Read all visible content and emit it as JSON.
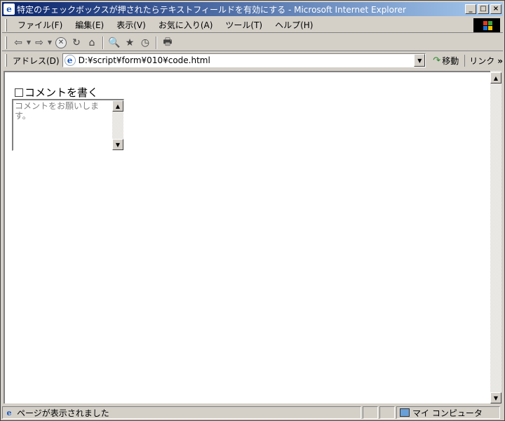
{
  "window": {
    "title": "特定のチェックボックスが押されたらテキストフィールドを有効にする - Microsoft Internet Explorer",
    "icon": "ie-icon",
    "controls": {
      "minimize": "_",
      "maximize": "□",
      "close": "×"
    }
  },
  "menu": {
    "items": [
      {
        "label": "ファイル(F)"
      },
      {
        "label": "編集(E)"
      },
      {
        "label": "表示(V)"
      },
      {
        "label": "お気に入り(A)"
      },
      {
        "label": "ツール(T)"
      },
      {
        "label": "ヘルプ(H)"
      }
    ]
  },
  "toolbar": {
    "back": "⇦",
    "forward": "⇨",
    "dropdown": "▼",
    "stop": "✕",
    "refresh": "↻",
    "home": "⌂",
    "search": "🔍",
    "favorites": "★",
    "history": "◷",
    "print": "🖶"
  },
  "address": {
    "label": "アドレス(D)",
    "url": "D:¥script¥form¥010¥code.html",
    "dropdown": "▼",
    "go_label": "移動",
    "go_arrow": "↷",
    "links_label": "リンク",
    "chevron": "»"
  },
  "page": {
    "checkbox_label": "コメントを書く",
    "checkbox_checked": false,
    "textarea_placeholder": "コメントをお願いします。"
  },
  "scroll": {
    "up": "▲",
    "down": "▼"
  },
  "status": {
    "text": "ページが表示されました",
    "zone": "マイ コンピュータ"
  },
  "colors": {
    "titlebar_start": "#0a246a",
    "titlebar_end": "#a6caf0",
    "chrome": "#d4d0c8",
    "placeholder": "#808080"
  }
}
